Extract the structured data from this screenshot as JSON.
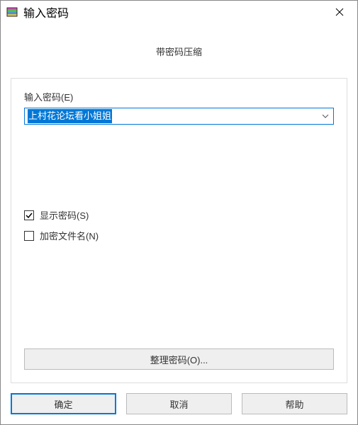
{
  "titlebar": {
    "title": "输入密码"
  },
  "subtitle": "带密码压缩",
  "field": {
    "label": "输入密码(E)",
    "value": "上村花论坛看小姐姐"
  },
  "checkboxes": {
    "show_password": {
      "label": "显示密码(S)",
      "checked": true
    },
    "encrypt_filenames": {
      "label": "加密文件名(N)",
      "checked": false
    }
  },
  "manage_button": "整理密码(O)...",
  "buttons": {
    "ok": "确定",
    "cancel": "取消",
    "help": "帮助"
  }
}
